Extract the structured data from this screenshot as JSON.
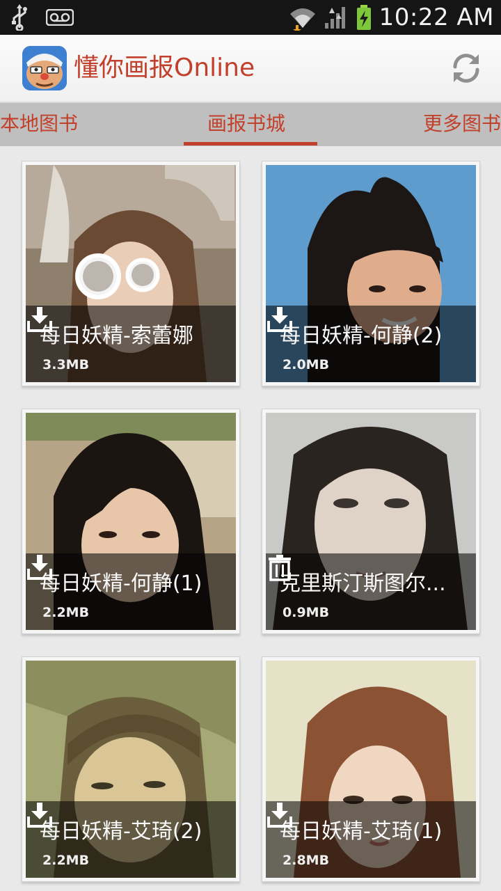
{
  "status_bar": {
    "time": "10:22 AM",
    "icons": [
      "usb-icon",
      "voicemail-icon",
      "wifi-icon",
      "signal-icon",
      "battery-charging-icon"
    ]
  },
  "action_bar": {
    "app_title": "懂你画报Online",
    "app_icon": "app-logo-icon",
    "refresh_icon": "refresh-icon"
  },
  "tabs": [
    {
      "label": "本地图书"
    },
    {
      "label": "画报书城",
      "selected": true
    },
    {
      "label": "更多图书"
    }
  ],
  "colors": {
    "accent": "#c2402b",
    "tab_bar": "#bfbfbf",
    "background": "#e9e9e9"
  },
  "items": [
    {
      "title": "每日妖精-索蕾娜",
      "size": "3.3MB",
      "action_icon": "download-icon"
    },
    {
      "title": "每日妖精-何静(2)",
      "size": "2.0MB",
      "action_icon": "download-icon"
    },
    {
      "title": "每日妖精-何静(1)",
      "size": "2.2MB",
      "action_icon": "download-icon"
    },
    {
      "title": "克里斯汀斯图尔...",
      "size": "0.9MB",
      "action_icon": "delete-icon"
    },
    {
      "title": "每日妖精-艾琦(2)",
      "size": "2.2MB",
      "action_icon": "download-icon"
    },
    {
      "title": "每日妖精-艾琦(1)",
      "size": "2.8MB",
      "action_icon": "download-icon"
    }
  ]
}
